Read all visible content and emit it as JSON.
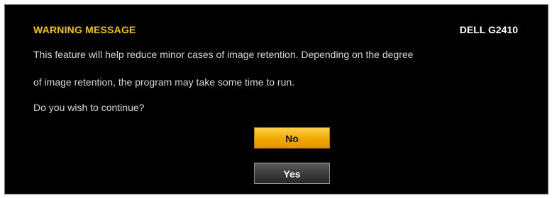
{
  "dialog": {
    "title": "WARNING MESSAGE",
    "model": "DELL G2410",
    "message_lines": [
      "This feature will help reduce minor cases of image retention. Depending on the degree",
      "of image retention, the program may take some time to run.",
      "Do you wish to continue?"
    ],
    "buttons": {
      "no_label": "No",
      "yes_label": "Yes"
    }
  },
  "colors": {
    "background": "#000000",
    "title": "#f5c400",
    "selected_button": "#f2a800",
    "unselected_button": "#3a3a3a"
  }
}
